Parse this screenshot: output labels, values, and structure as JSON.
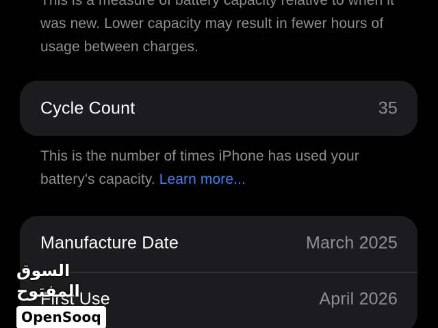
{
  "capacity_note": "This is a measure of battery capacity relative to when it was new. Lower capacity may result in fewer hours of usage between charges.",
  "cycle_count": {
    "label": "Cycle Count",
    "value": "35"
  },
  "cycle_note": {
    "text": "This is the number of times iPhone has used your battery's capacity.",
    "link": "Learn more..."
  },
  "dates": [
    {
      "label": "Manufacture Date",
      "value": "March 2025"
    },
    {
      "label": "First Use",
      "value": "April 2026"
    }
  ],
  "watermark": {
    "arabic": "السوق المفتوح",
    "latin": "OpenSooq"
  },
  "colors": {
    "background": "#000000",
    "card": "#1c1c1e",
    "secondary_text": "#8e8e93",
    "link": "#3b82f6"
  }
}
